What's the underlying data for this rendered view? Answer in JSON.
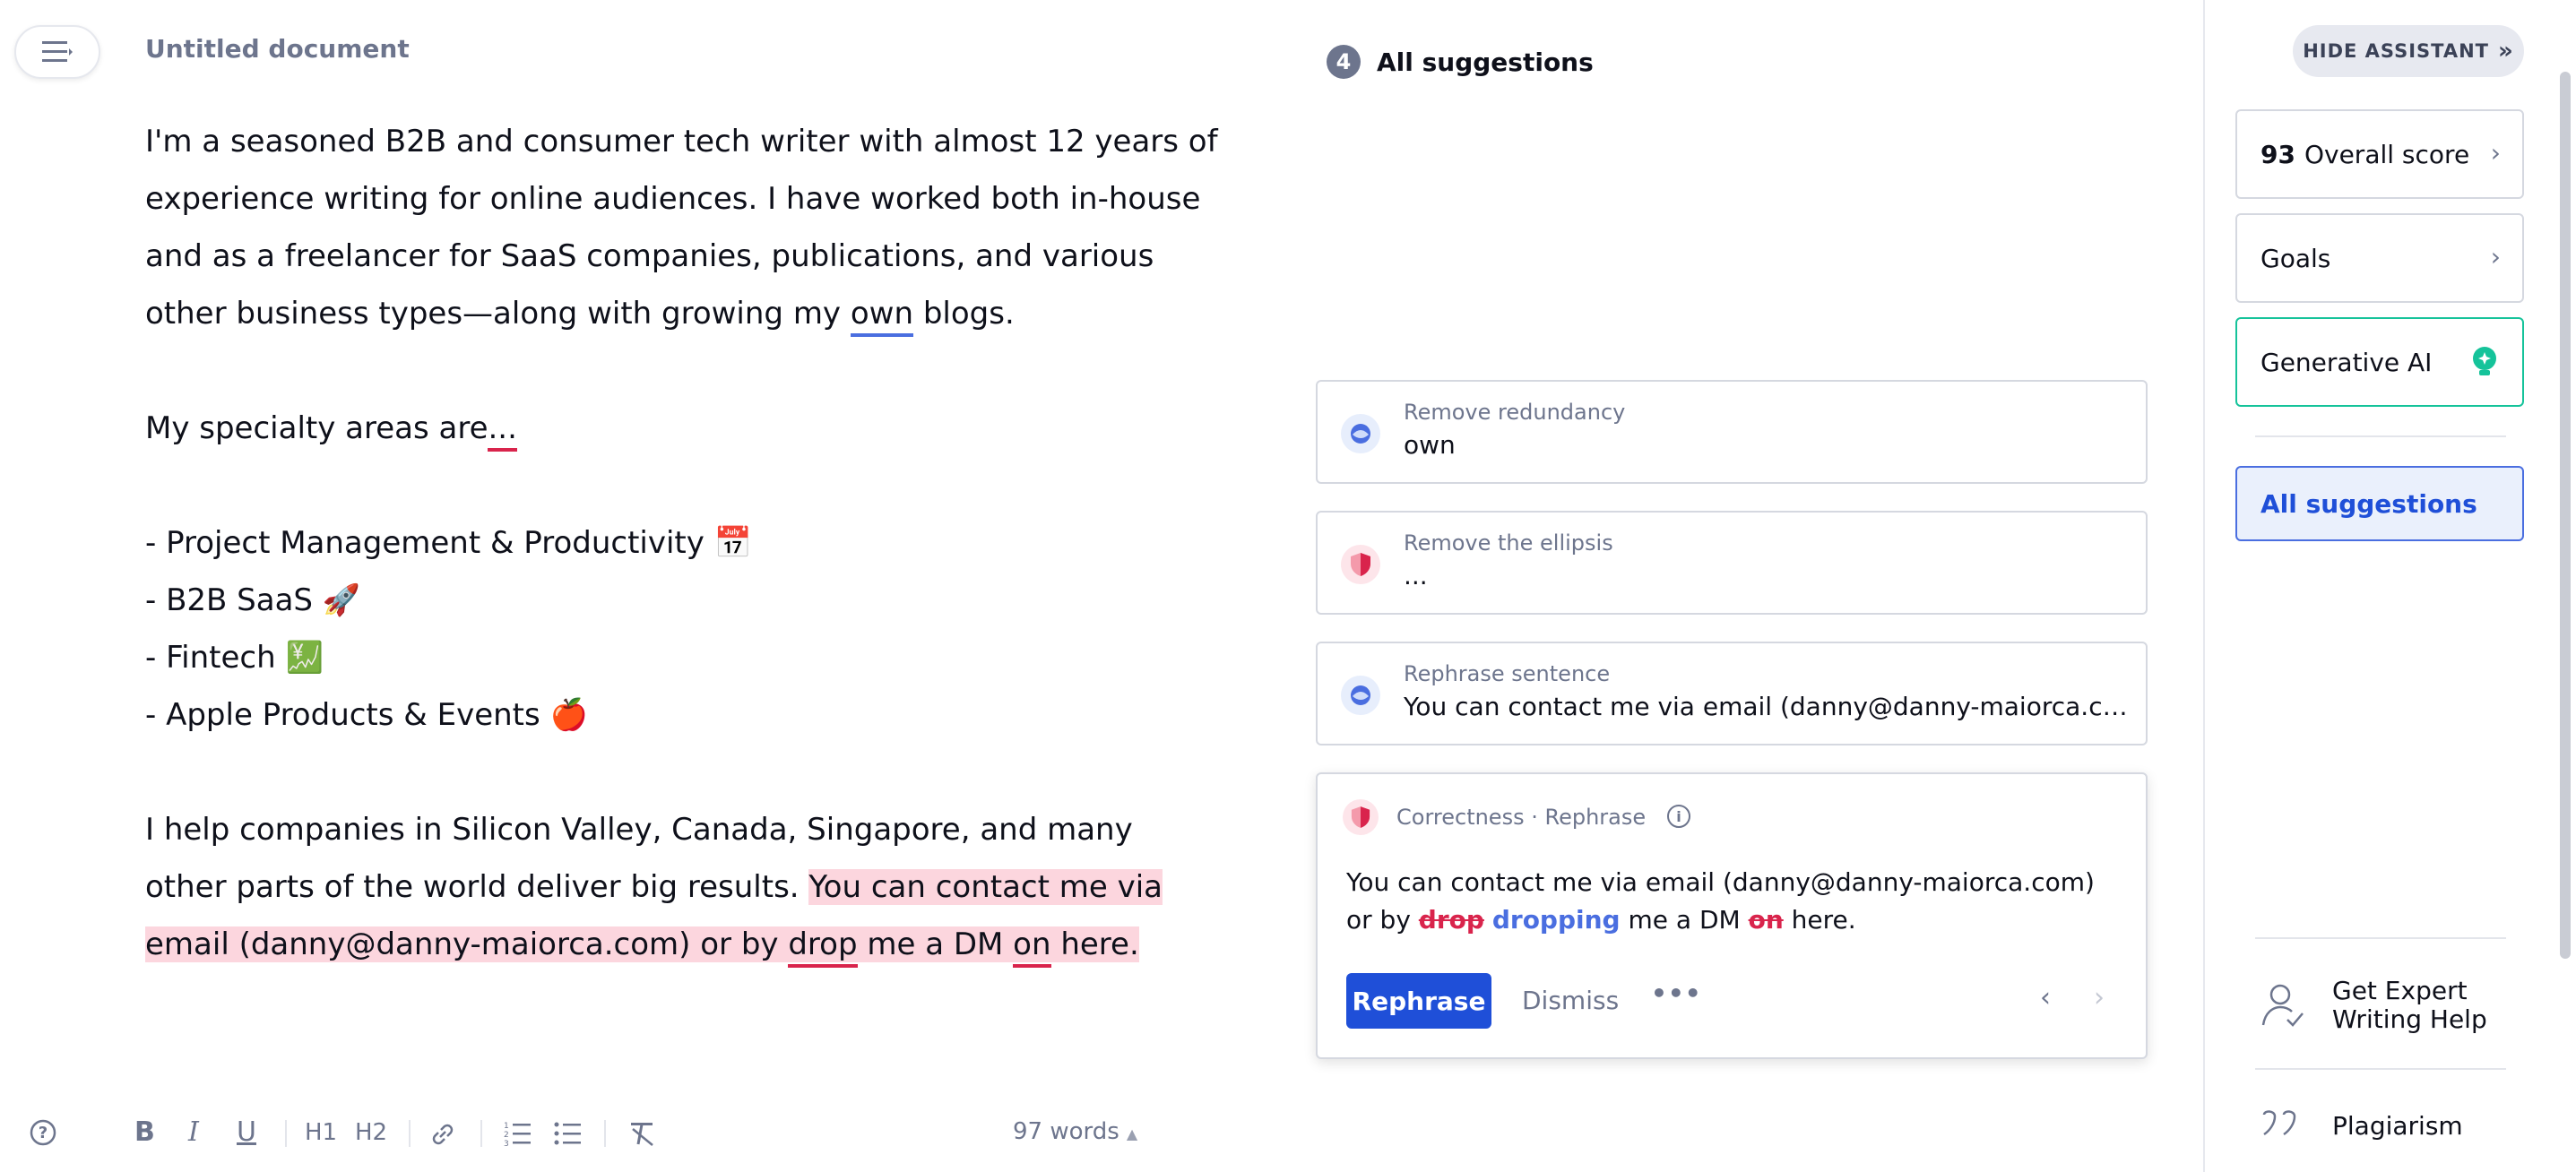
{
  "document": {
    "title": "Untitled document",
    "p1": {
      "before": "I'm a seasoned B2B and consumer tech writer with almost 12 years of experience writing for online audiences. I have worked both in-house and as a freelancer for SaaS companies, publications, and various other business types—along with growing my ",
      "flagged": "own",
      "after": " blogs."
    },
    "p2": {
      "before": "My specialty areas are",
      "flagged": "..."
    },
    "list": [
      "- Project Management & Productivity 📅",
      "- B2B SaaS 🚀",
      "- Fintech 💹",
      "- Apple Products & Events 🍎"
    ],
    "p3": {
      "plain": "I help companies in Silicon Valley, Canada, Singapore, and many other parts of the world deliver big results. ",
      "hl_1": "You can contact me via email (danny@danny-maiorca.com) or by ",
      "hl_drop": "drop",
      "hl_2": " me a DM ",
      "hl_on": "on",
      "hl_3": " here."
    }
  },
  "toolbar": {
    "help": "?",
    "bold": "B",
    "italic": "I",
    "underline": "U",
    "h1": "H1",
    "h2": "H2",
    "word_count": "97 words"
  },
  "suggestions": {
    "count": "4",
    "title": "All suggestions",
    "cards": [
      {
        "category": "Remove redundancy",
        "text": "own"
      },
      {
        "category": "Remove the ellipsis",
        "text": "..."
      },
      {
        "category": "Rephrase sentence",
        "text": "You can contact me via email (danny@danny-maiorca.com)..."
      }
    ],
    "expanded": {
      "header": "Correctness · Rephrase",
      "body_1": "You can contact me via email (danny@danny-maiorca.com) or by ",
      "deleted_1": "drop",
      "inserted_1": "dropping",
      "body_2": " me a DM ",
      "deleted_2": "on",
      "body_3": "here.",
      "primary_button": "Rephrase",
      "dismiss_button": "Dismiss"
    }
  },
  "sidebar": {
    "hide_label": "HIDE ASSISTANT",
    "score_value": "93",
    "score_label": "Overall score",
    "goals_label": "Goals",
    "genai_label": "Generative AI",
    "all_suggestions_label": "All suggestions",
    "expert_line1": "Get Expert",
    "expert_line2": "Writing Help",
    "plagiarism_label": "Plagiarism"
  },
  "colors": {
    "accent": "#1f4fd8",
    "error": "#d9244c",
    "highlight": "#fcd6de",
    "genai": "#15c39a"
  }
}
